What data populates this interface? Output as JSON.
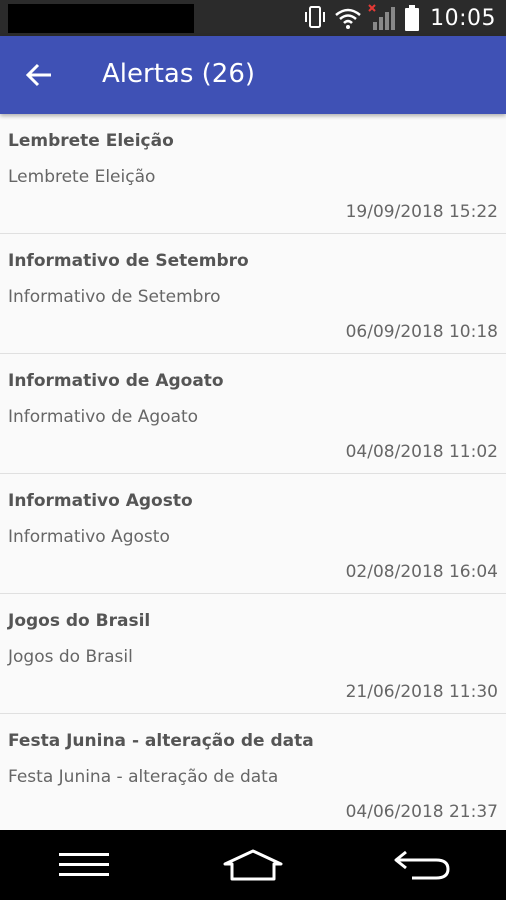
{
  "status_bar": {
    "time": "10:05",
    "icons": [
      "vibrate-icon",
      "wifi-icon",
      "signal-no-service-icon",
      "battery-icon"
    ]
  },
  "app_bar": {
    "title": "Alertas (26)",
    "back_icon": "arrow-left-icon"
  },
  "alerts": [
    {
      "title": "Lembrete Eleição",
      "body": "Lembrete Eleição",
      "date": "19/09/2018 15:22"
    },
    {
      "title": "Informativo de Setembro",
      "body": "Informativo de Setembro",
      "date": "06/09/2018 10:18"
    },
    {
      "title": "Informativo de Agoato",
      "body": "Informativo de Agoato",
      "date": "04/08/2018 11:02"
    },
    {
      "title": "Informativo Agosto",
      "body": "Informativo Agosto",
      "date": "02/08/2018 16:04"
    },
    {
      "title": "Jogos do Brasil",
      "body": "Jogos do Brasil",
      "date": "21/06/2018 11:30"
    },
    {
      "title": "Festa Junina - alteração de data",
      "body": "Festa Junina - alteração de data",
      "date": "04/06/2018 21:37"
    }
  ],
  "nav_bar": {
    "buttons": [
      "menu-icon",
      "home-icon",
      "back-icon"
    ]
  },
  "colors": {
    "app_bar": "#3f51b5",
    "status_bar": "#2b2b2b",
    "list_background": "#fafafa",
    "title_text": "#555555",
    "secondary_text": "#666666"
  }
}
